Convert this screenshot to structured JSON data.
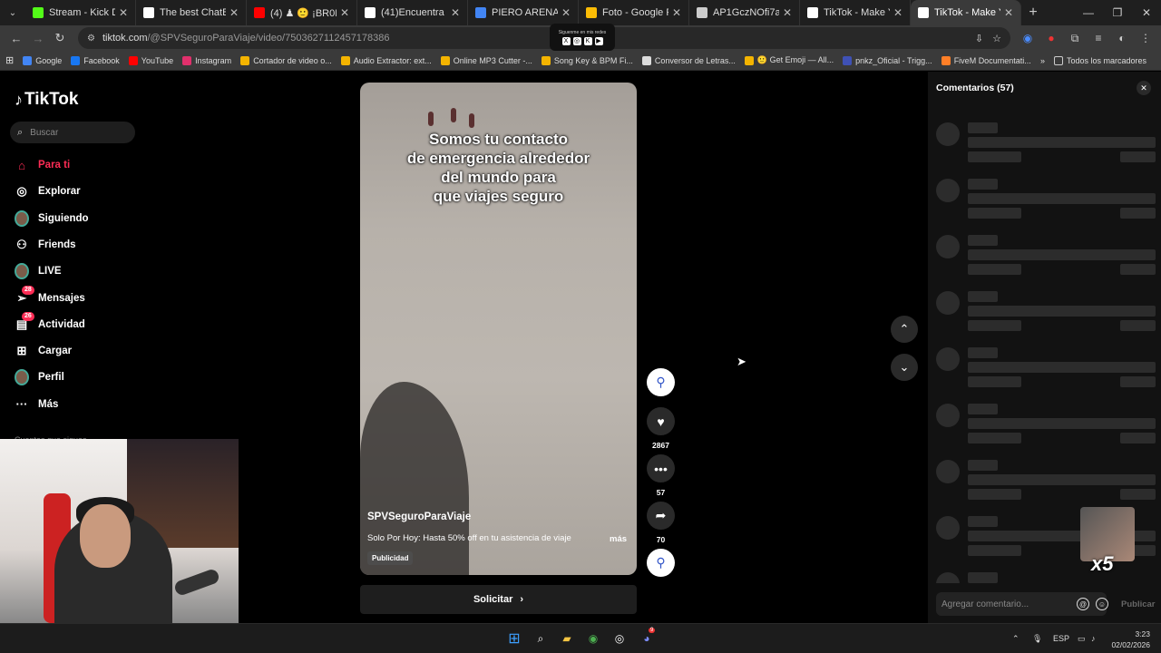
{
  "browser": {
    "tabs": [
      {
        "label": "Stream - Kick Dashbo",
        "color": "#53fc18"
      },
      {
        "label": "The best ChatBot and",
        "color": "#ffffff"
      },
      {
        "label": "(4) ♟ 🙂 ¡BR0NC4S",
        "color": "#ff0000"
      },
      {
        "label": "(41)Encuentra 'OJERA",
        "color": "#ffffff"
      },
      {
        "label": "PIERO ARENAS - Bus",
        "color": "#4285f4"
      },
      {
        "label": "Foto - Google Fotos",
        "color": "#fbbc05"
      },
      {
        "label": "AP1GczNOfi7a15uW",
        "color": "#cccccc"
      },
      {
        "label": "TikTok - Make Your D",
        "color": "#ffffff"
      },
      {
        "label": "TikTok - Make Yo",
        "color": "#ffffff",
        "active": true
      }
    ],
    "url_host": "tiktok.com",
    "url_path": "/@SPVSeguroParaViaje/video/7503627112457178386",
    "overlay_text": "Siguenme en mis redes",
    "bookmarks": [
      {
        "label": "Google",
        "color": "#4285f4"
      },
      {
        "label": "Facebook",
        "color": "#1877f2"
      },
      {
        "label": "YouTube",
        "color": "#ff0000"
      },
      {
        "label": "Instagram",
        "color": "#e1306c"
      },
      {
        "label": "Cortador de video o...",
        "color": "#f4b400"
      },
      {
        "label": "Audio Extractor: ext...",
        "color": "#f4b400"
      },
      {
        "label": "Online MP3 Cutter -...",
        "color": "#f4b400"
      },
      {
        "label": "Song Key & BPM Fi...",
        "color": "#f4b400"
      },
      {
        "label": "Conversor de Letras...",
        "color": "#dddddd"
      },
      {
        "label": "🙂 Get Emoji — All...",
        "color": "#f4b400"
      },
      {
        "label": "pnkz_Oficial - Trigg...",
        "color": "#3f51b5"
      },
      {
        "label": "FiveM Documentati...",
        "color": "#ff7f27"
      }
    ],
    "bookmarks_folder": "Todos los marcadores"
  },
  "sidebar": {
    "logo": "TikTok",
    "search_placeholder": "Buscar",
    "nav": [
      {
        "label": "Para ti",
        "icon": "home-icon",
        "active": true
      },
      {
        "label": "Explorar",
        "icon": "compass-icon"
      },
      {
        "label": "Siguiendo",
        "icon": "following-avatar"
      },
      {
        "label": "Friends",
        "icon": "friends-icon"
      },
      {
        "label": "LIVE",
        "icon": "live-avatar"
      },
      {
        "label": "Mensajes",
        "icon": "paper-plane-icon",
        "badge": "28"
      },
      {
        "label": "Actividad",
        "icon": "inbox-icon",
        "badge": "26"
      },
      {
        "label": "Cargar",
        "icon": "plus-square-icon"
      },
      {
        "label": "Perfil",
        "icon": "profile-avatar"
      },
      {
        "label": "Más",
        "icon": "more-icon"
      }
    ],
    "following_heading": "Cuentas que sigues"
  },
  "video": {
    "caption": [
      "Somos tu contacto",
      "de emergencia alrededor",
      "del mundo para",
      "que viajes seguro"
    ],
    "author": "SPVSeguroParaViaje",
    "description": "Solo Por Hoy: Hasta 50% off en tu asistencia de viaje",
    "more": "más",
    "ad_label": "Publicidad",
    "cta": "Solicitar"
  },
  "actions": {
    "likes": "2867",
    "comments": "57",
    "shares": "70"
  },
  "comments": {
    "title": "Comentarios",
    "count": "(57)",
    "input_placeholder": "Agregar comentario...",
    "publish": "Publicar",
    "multiplier": "x5"
  },
  "taskbar": {
    "lang": "ESP",
    "time": "3:23",
    "date": "02/02/2026",
    "chat_badge": "9"
  },
  "colors": {
    "accent": "#fe2c55"
  }
}
